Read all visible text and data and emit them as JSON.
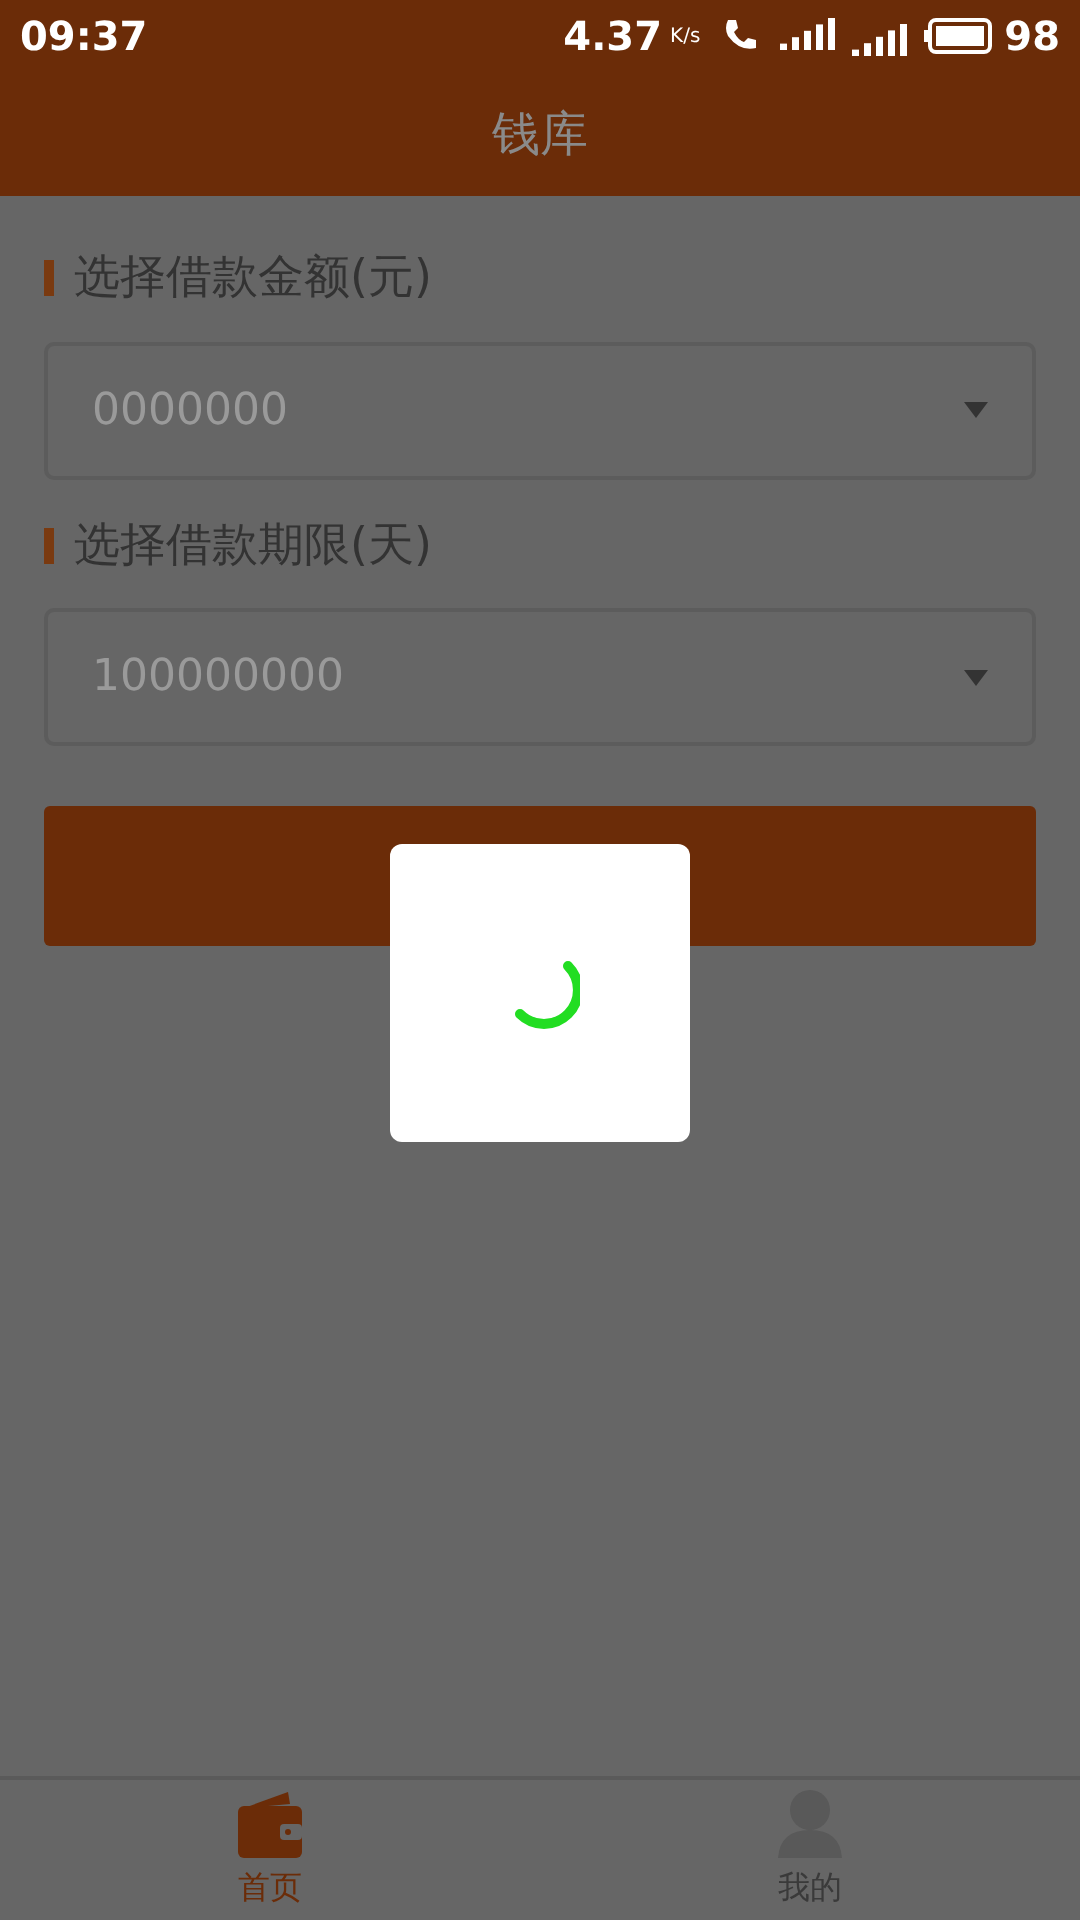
{
  "status_bar": {
    "time": "09:37",
    "speed": "4.37",
    "speed_unit": "K/s",
    "battery": "98"
  },
  "header": {
    "title": "钱库"
  },
  "fields": [
    {
      "label": "选择借款金额(元)",
      "placeholder": "0000000"
    },
    {
      "label": "选择借款期限(天)",
      "placeholder": "100000000"
    }
  ],
  "loading": {
    "visible": true
  },
  "tabs": [
    {
      "label": "首页",
      "kind": "wallet",
      "selected": true
    },
    {
      "label": "我的",
      "kind": "person",
      "selected": false
    }
  ]
}
